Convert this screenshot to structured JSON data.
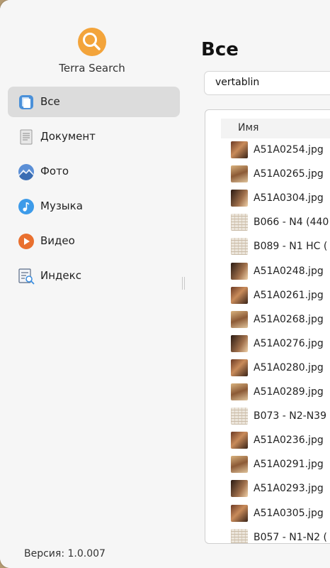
{
  "app": {
    "name": "Terra Search",
    "version_label": "Версия: 1.0.007"
  },
  "sidebar": {
    "items": [
      {
        "label": "Все",
        "icon": "all-files-icon",
        "active": true
      },
      {
        "label": "Документ",
        "icon": "document-icon",
        "active": false
      },
      {
        "label": "Фото",
        "icon": "photo-icon",
        "active": false
      },
      {
        "label": "Музыка",
        "icon": "music-icon",
        "active": false
      },
      {
        "label": "Видео",
        "icon": "video-icon",
        "active": false
      },
      {
        "label": "Индекс",
        "icon": "index-icon",
        "active": false
      }
    ]
  },
  "main": {
    "title": "Все",
    "search": {
      "value": "vertablin"
    },
    "column_header": "Имя",
    "files": [
      {
        "name": "A51A0254.jpg",
        "thumb": "photo"
      },
      {
        "name": "A51A0265.jpg",
        "thumb": "photo"
      },
      {
        "name": "A51A0304.jpg",
        "thumb": "photo"
      },
      {
        "name": "B066 - N4 (440",
        "thumb": "sheet"
      },
      {
        "name": "B089 - N1 HC (",
        "thumb": "sheet"
      },
      {
        "name": "A51A0248.jpg",
        "thumb": "photo"
      },
      {
        "name": "A51A0261.jpg",
        "thumb": "photo"
      },
      {
        "name": "A51A0268.jpg",
        "thumb": "photo"
      },
      {
        "name": "A51A0276.jpg",
        "thumb": "photo"
      },
      {
        "name": "A51A0280.jpg",
        "thumb": "photo"
      },
      {
        "name": "A51A0289.jpg",
        "thumb": "photo"
      },
      {
        "name": "B073 - N2-N39",
        "thumb": "sheet"
      },
      {
        "name": "A51A0236.jpg",
        "thumb": "photo"
      },
      {
        "name": "A51A0291.jpg",
        "thumb": "photo"
      },
      {
        "name": "A51A0293.jpg",
        "thumb": "photo"
      },
      {
        "name": "A51A0305.jpg",
        "thumb": "photo"
      },
      {
        "name": "B057 - N1-N2 (",
        "thumb": "sheet"
      }
    ]
  },
  "colors": {
    "accent": "#f3a43b",
    "active_bg": "#dcdcdc"
  }
}
